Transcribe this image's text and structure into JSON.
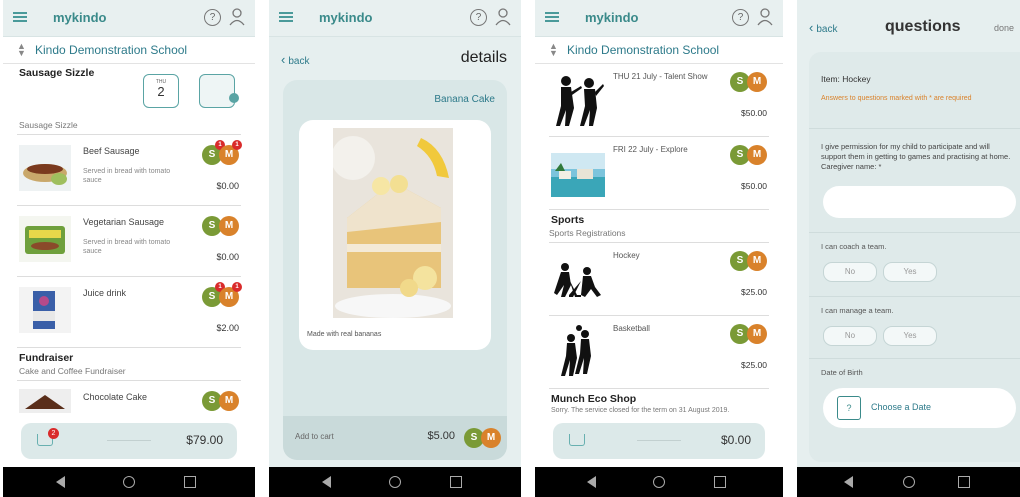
{
  "s1": {
    "logo": "mykindo",
    "help": "?",
    "school": "Kindo Demonstration School",
    "section_title": "Sausage Sizzle",
    "date_badge_day": "2",
    "date_badge_top": "THU",
    "sub_title": "Sausage Sizzle",
    "items": [
      {
        "name": "Beef Sausage",
        "desc": "Served in bread with tomato sauce",
        "price": "$0.00",
        "s": "S",
        "m": "M",
        "s_count": "1",
        "m_count": "1"
      },
      {
        "name": "Vegetarian Sausage",
        "desc": "Served in bread with tomato sauce",
        "price": "$0.00",
        "s": "S",
        "m": "M"
      },
      {
        "name": "Juice drink",
        "desc": "",
        "price": "$2.00",
        "s": "S",
        "m": "M",
        "s_count": "1",
        "m_count": "1"
      }
    ],
    "fundraiser_title": "Fundraiser",
    "fundraiser_sub": "Cake and Coffee Fundraiser",
    "last_item": {
      "name": "Chocolate Cake",
      "s": "S",
      "m": "M"
    },
    "cart_count": "2",
    "cart_total": "$79.00"
  },
  "s2": {
    "logo": "mykindo",
    "help": "?",
    "back": "back",
    "title": "details",
    "item_name": "Banana Cake",
    "caption": "Made with real bananas",
    "add_label": "Add to cart",
    "price": "$5.00",
    "s": "S",
    "m": "M"
  },
  "s3": {
    "logo": "mykindo",
    "help": "?",
    "school": "Kindo Demonstration School",
    "items_top": [
      {
        "name": "THU 21 July - Talent Show",
        "price": "$50.00",
        "s": "S",
        "m": "M"
      },
      {
        "name": "FRI 22 July - Explore",
        "price": "$50.00",
        "s": "S",
        "m": "M"
      }
    ],
    "sports_title": "Sports",
    "sports_sub": "Sports Registrations",
    "items_sports": [
      {
        "name": "Hockey",
        "price": "$25.00",
        "s": "S",
        "m": "M"
      },
      {
        "name": "Basketball",
        "price": "$25.00",
        "s": "S",
        "m": "M"
      }
    ],
    "shop_title": "Munch Eco Shop",
    "shop_sub": "Sorry. The service closed for the term on 31 August 2019.",
    "cart_total": "$0.00"
  },
  "s4": {
    "back": "back",
    "title": "questions",
    "done": "done",
    "item": "Item: Hockey",
    "required": "Answers to questions marked with * are required",
    "permission": "I give permission for my child to participate and will support them in getting to games and practising at home. Caregiver name: *",
    "coach": "I can coach a team.",
    "manage": "I can manage a team.",
    "no": "No",
    "yes": "Yes",
    "dob": "Date of Birth",
    "choose_date": "Choose a Date",
    "cal_glyph": "?"
  },
  "colors": {
    "teal": "#2d7a8a",
    "s_badge": "#7a9a36",
    "m_badge": "#d9822b",
    "alert": "#d92b2b"
  }
}
